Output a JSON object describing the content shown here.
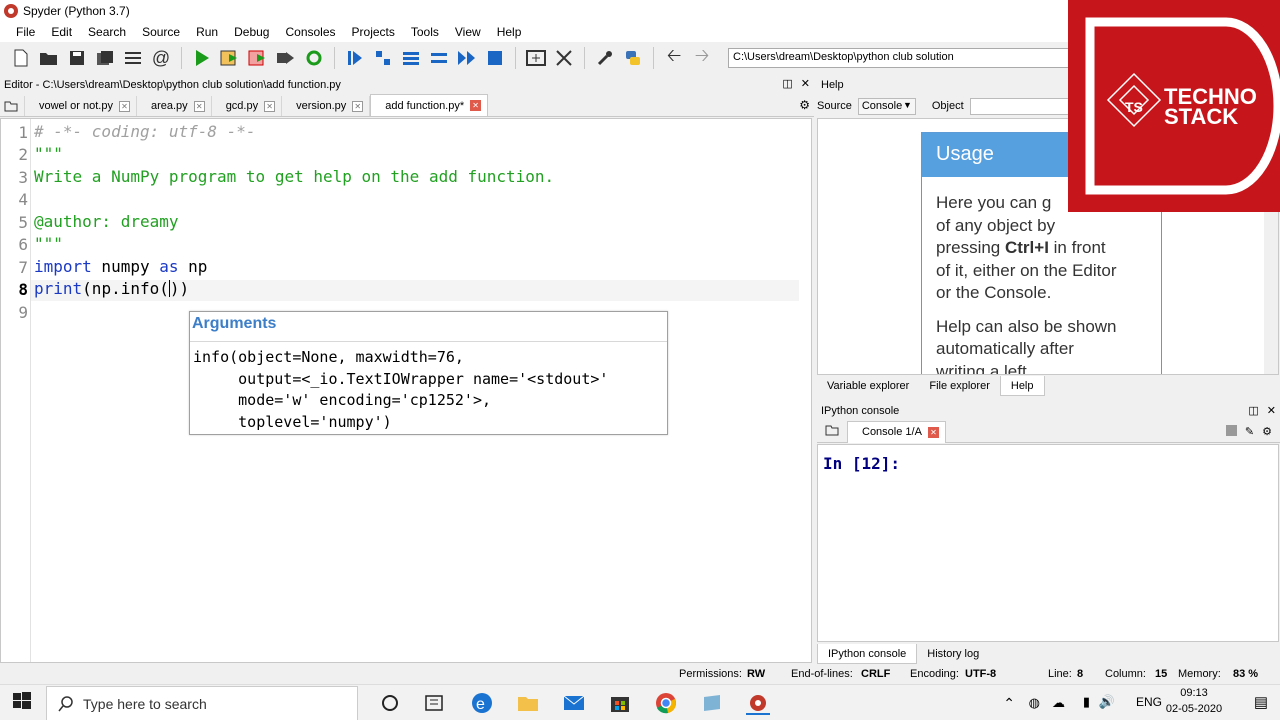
{
  "window": {
    "title": "Spyder (Python 3.7)"
  },
  "menu": [
    "File",
    "Edit",
    "Search",
    "Source",
    "Run",
    "Debug",
    "Consoles",
    "Projects",
    "Tools",
    "View",
    "Help"
  ],
  "toolbar": {
    "path": "C:\\Users\\dream\\Desktop\\python club solution"
  },
  "editor": {
    "header": "Editor - C:\\Users\\dream\\Desktop\\python club solution\\add function.py",
    "tabs": [
      {
        "label": "vowel or not.py"
      },
      {
        "label": "area.py"
      },
      {
        "label": "gcd.py"
      },
      {
        "label": "version.py"
      },
      {
        "label": "add function.py*"
      }
    ],
    "line_numbers": [
      "1",
      "2",
      "3",
      "4",
      "5",
      "6",
      "7",
      "8",
      "9"
    ],
    "code": {
      "l1": "# -*- coding: utf-8 -*-",
      "l2": "\"\"\"",
      "l3": "Write a NumPy program to get help on the add function.",
      "l5": "@author: dreamy",
      "l6": "\"\"\"",
      "l7_kw1": "import",
      "l7_mid": " numpy ",
      "l7_kw2": "as",
      "l7_end": " np",
      "l8_fn": "print",
      "l8_rest": "(np.info(",
      "l8_close": "))"
    },
    "calltip": {
      "title": "Arguments",
      "signature": "info(object=None, maxwidth=76,\n     output=<_io.TextIOWrapper name='<stdout>'\n     mode='w' encoding='cp1252'>,\n     toplevel='numpy')"
    }
  },
  "help": {
    "header": "Help",
    "source_label": "Source",
    "source_value": "Console",
    "object_label": "Object",
    "usage_title": "Usage",
    "usage_text_1": "Here you can g",
    "usage_text_2": "of any object by",
    "usage_text_3a": "pressing ",
    "usage_text_3b": "Ctrl+I",
    "usage_text_3c": " in front",
    "usage_text_4": "of it, either on the Editor",
    "usage_text_5": "or the Console.",
    "usage_text_6": "Help can also be shown",
    "usage_text_7": "automatically after",
    "usage_text_8": "writing a left",
    "tabs": [
      "Variable explorer",
      "File explorer",
      "Help"
    ]
  },
  "ipython": {
    "header": "IPython console",
    "tab": "Console 1/A",
    "prompt": "In [12]:",
    "tabs": [
      "IPython console",
      "History log"
    ]
  },
  "status": {
    "permissions_label": "Permissions:",
    "permissions": "RW",
    "eol_label": "End-of-lines:",
    "eol": "CRLF",
    "encoding_label": "Encoding:",
    "encoding": "UTF-8",
    "line_label": "Line:",
    "line": "8",
    "column_label": "Column:",
    "column": "15",
    "memory_label": "Memory:",
    "memory": "83 %"
  },
  "taskbar": {
    "search_placeholder": "Type here to search",
    "language": "ENG",
    "time": "09:13",
    "date": "02-05-2020"
  },
  "logo": {
    "line1": "TECHNO",
    "line2": "STACK",
    "badge": "TS"
  },
  "colors": {
    "brand_red": "#c6161b",
    "usage_blue": "#56a0e0",
    "keyword": "#1a39c4",
    "string": "#22a022",
    "comment": "#a0a0a0"
  }
}
